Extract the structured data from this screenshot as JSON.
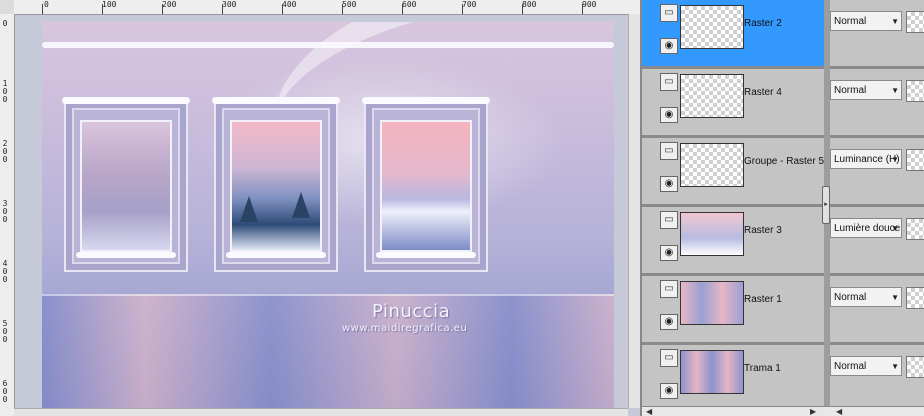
{
  "ruler": {
    "top_labels": [
      "0",
      "100",
      "200",
      "300",
      "400",
      "500",
      "600",
      "700",
      "800",
      "900"
    ],
    "left_labels": [
      "0",
      "1\n0\n0",
      "2\n0\n0",
      "3\n0\n0",
      "4\n0\n0",
      "5\n0\n0",
      "6\n0\n0"
    ]
  },
  "image": {
    "watermark_title": "Pinuccia",
    "watermark_url": "www.maidiregrafica.eu"
  },
  "layers": [
    {
      "name": "Raster 2",
      "blend": "Normal",
      "selected": true
    },
    {
      "name": "Raster 4",
      "blend": "Normal",
      "selected": false
    },
    {
      "name": "Groupe - Raster 5",
      "blend": "Luminance (H)",
      "selected": false
    },
    {
      "name": "Raster 3",
      "blend": "Lumière douce",
      "selected": false
    },
    {
      "name": "Raster 1",
      "blend": "Normal",
      "selected": false
    },
    {
      "name": "Trama 1",
      "blend": "Normal",
      "selected": false
    }
  ],
  "colors": {
    "selected_layer": "#3399ff",
    "panel_bg": "#c4c4c4"
  },
  "icons": {
    "eye": "eye-icon",
    "layer_type": "layer-type-icon",
    "dropdown": "chevron-down-icon"
  }
}
